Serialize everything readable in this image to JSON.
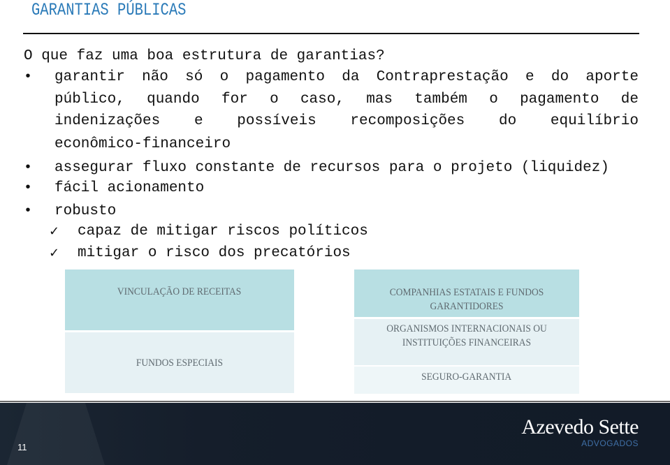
{
  "header": {
    "title": "GARANTIAS PÚBLICAS"
  },
  "content": {
    "question": "O que faz uma boa estrutura de garantias?",
    "bullet_symbol": "•",
    "check_symbol": "✓",
    "bullets": [
      {
        "lines": [
          [
            "garantir",
            "não",
            "só",
            "o",
            "pagamento",
            "da",
            "Contraprestação",
            "e",
            "do",
            "aporte"
          ],
          [
            "público,",
            "quando",
            "for",
            "o",
            "caso,",
            "mas",
            "também",
            "o",
            "pagamento",
            "de"
          ],
          [
            "indenizações",
            "e",
            "possíveis",
            "recomposições",
            "do",
            "equilíbrio"
          ],
          [
            "econômico-financeiro"
          ]
        ]
      },
      {
        "text": "assegurar fluxo constante de recursos para o projeto (liquidez)"
      },
      {
        "text": "fácil acionamento"
      },
      {
        "text": "robusto"
      }
    ],
    "sub_items": [
      "capaz de mitigar riscos políticos",
      "mitigar o risco dos precatórios"
    ]
  },
  "boxes": {
    "left": [
      "VINCULAÇÃO DE RECEITAS",
      "FUNDOS ESPECIAIS"
    ],
    "right": [
      "COMPANHIAS ESTATAIS E FUNDOS GARANTIDORES",
      "ORGANISMOS INTERNACIONAIS OU INSTITUIÇÕES FINANCEIRAS",
      "SEGURO-GARANTIA"
    ]
  },
  "footer": {
    "page_number": "11",
    "logo_name": "Azevedo Sette",
    "logo_sub": "ADVOGADOS"
  }
}
